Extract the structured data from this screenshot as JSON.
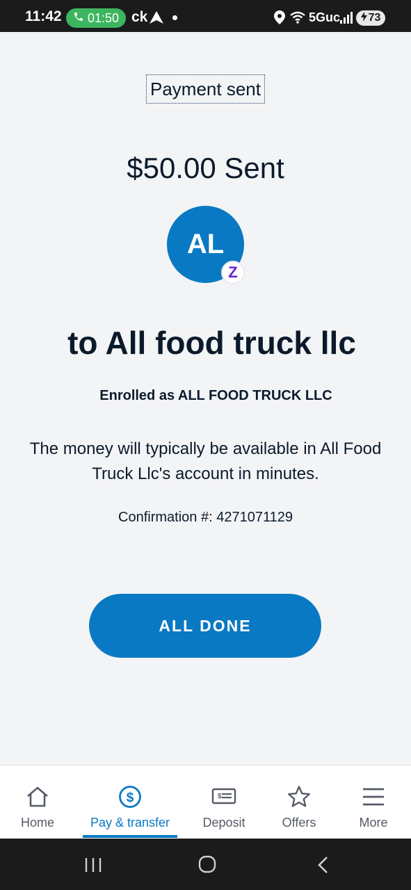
{
  "status_bar": {
    "time": "11:42",
    "call_timer": "01:50",
    "carrier_text": "ck",
    "network": "5Guc",
    "battery": "73"
  },
  "main": {
    "title": "Payment sent",
    "amount_text": "$50.00 Sent",
    "avatar_initials": "AL",
    "recipient_text": "to All food truck llc",
    "enrolled_text": "Enrolled as ALL FOOD TRUCK LLC",
    "availability_text": "The money will typically be available in All Food Truck Llc's account in minutes.",
    "confirmation_text": "Confirmation #: 4271071129",
    "done_button_label": "ALL DONE"
  },
  "bottom_nav": {
    "active_index": 1,
    "items": [
      {
        "label": "Home",
        "icon": "home-icon"
      },
      {
        "label": "Pay & transfer",
        "icon": "dollar-circle-icon"
      },
      {
        "label": "Deposit",
        "icon": "check-deposit-icon"
      },
      {
        "label": "Offers",
        "icon": "star-icon"
      },
      {
        "label": "More",
        "icon": "menu-icon"
      }
    ]
  },
  "colors": {
    "brand_blue": "#0a79c3",
    "zelle_purple": "#6d1ed4",
    "background": "#f3f4f6",
    "call_green": "#3cb560"
  }
}
